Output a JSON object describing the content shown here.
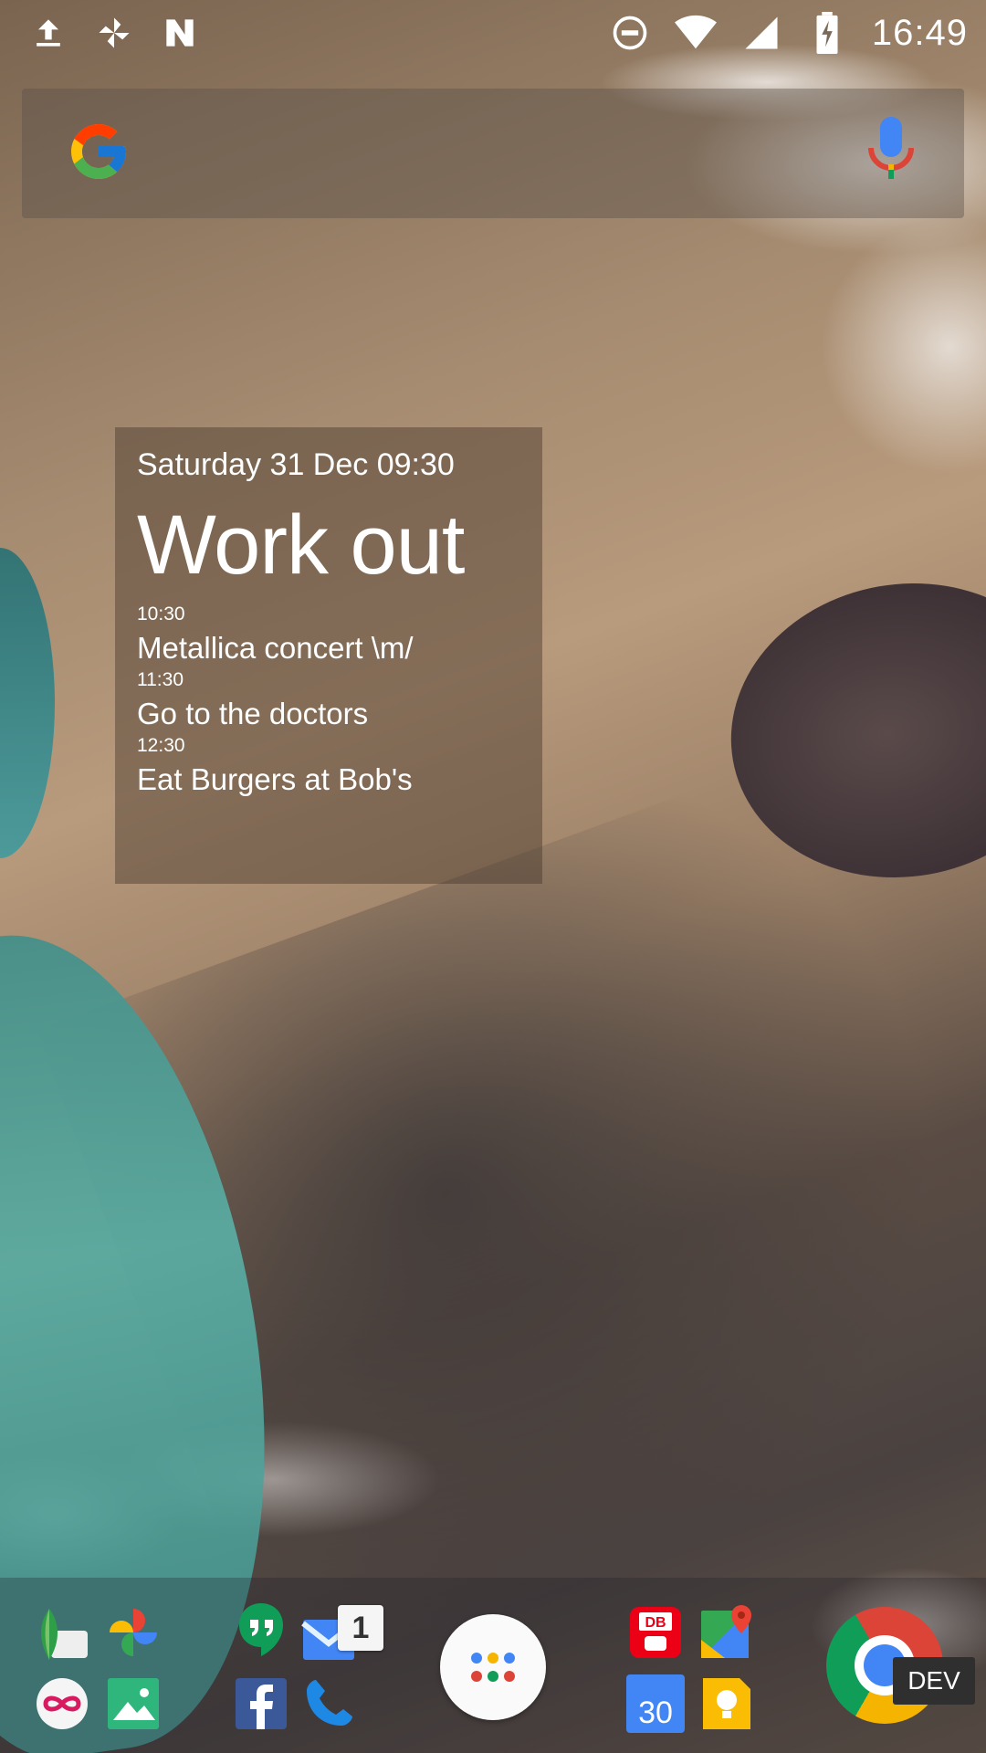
{
  "status_bar": {
    "time": "16:49",
    "left_icons": [
      "upload-icon",
      "pinwheel-icon",
      "n-logo-icon"
    ],
    "right_icons": [
      "do-not-disturb-icon",
      "wifi-icon",
      "cell-signal-icon",
      "battery-charging-icon"
    ]
  },
  "search_bar": {
    "logo": "google-g-icon",
    "voice": "mic-icon"
  },
  "agenda": {
    "date_line": "Saturday 31 Dec 09:30",
    "main_event": "Work out",
    "events": [
      {
        "time": "10:30",
        "title": "Metallica concert \\m/"
      },
      {
        "time": "11:30",
        "title": "Go to the doctors"
      },
      {
        "time": "12:30",
        "title": "Eat Burgers at Bob's"
      }
    ]
  },
  "dock": {
    "apps": [
      "snapseed-icon",
      "google-photos-icon",
      "infinity-app-icon",
      "gallery-icon",
      "hangouts-icon",
      "inbox-icon",
      "facebook-icon",
      "phone-icon",
      "app-drawer-icon",
      "db-navigator-icon",
      "google-maps-icon",
      "calendar-icon",
      "keep-icon",
      "chrome-dev-icon"
    ],
    "inbox_badge": "1",
    "calendar_day": "30",
    "chrome_label": "DEV"
  },
  "colors": {
    "google_blue": "#4285F4",
    "google_red": "#DB4437",
    "google_yellow": "#F4B400",
    "google_green": "#0F9D58"
  }
}
